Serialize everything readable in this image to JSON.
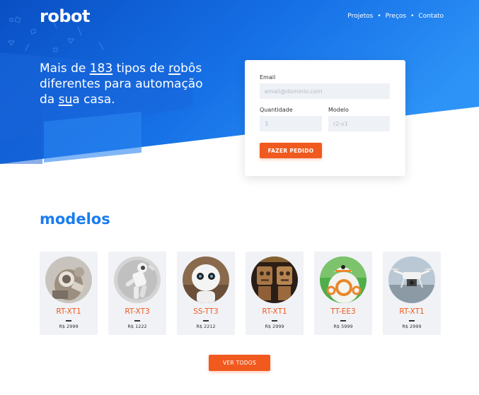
{
  "brand": {
    "logo": "robot"
  },
  "nav": {
    "items": [
      {
        "label": "Projetos"
      },
      {
        "label": "Preços"
      },
      {
        "label": "Contato"
      }
    ],
    "separator": "•"
  },
  "hero": {
    "headline_parts": {
      "p1": "Mais de ",
      "u1": "183",
      "p2": " tipos de ",
      "u2": "ro",
      "p3": "bôs diferentes para automação da ",
      "u3": "su",
      "p4": "a casa."
    }
  },
  "order_form": {
    "email_label": "Email",
    "email_placeholder": "email@dominio.com",
    "quantity_label": "Quantidade",
    "quantity_placeholder": "3",
    "model_label": "Modelo",
    "model_placeholder": "r2-v1",
    "submit_label": "FAZER PEDIDO"
  },
  "models_section": {
    "title": "modelos",
    "items": [
      {
        "name": "RT-XT1",
        "price": "R$ 2999",
        "image": "robot-arm-photo"
      },
      {
        "name": "RT-XT3",
        "price": "R$ 1222",
        "image": "humanoid-robot-photo"
      },
      {
        "name": "SS-TT3",
        "price": "R$ 2212",
        "image": "pepper-robot-photo"
      },
      {
        "name": "RT-XT1",
        "price": "R$ 2999",
        "image": "wooden-robots-photo"
      },
      {
        "name": "TT-EE3",
        "price": "R$ 5999",
        "image": "bb8-robot-photo"
      },
      {
        "name": "RT-XT1",
        "price": "R$ 2999",
        "image": "drone-photo"
      }
    ],
    "view_all_label": "VER TODOS"
  },
  "colors": {
    "primary_blue": "#1a7cf0",
    "accent_orange": "#f05a1e",
    "card_bg": "#f0f2f6"
  }
}
